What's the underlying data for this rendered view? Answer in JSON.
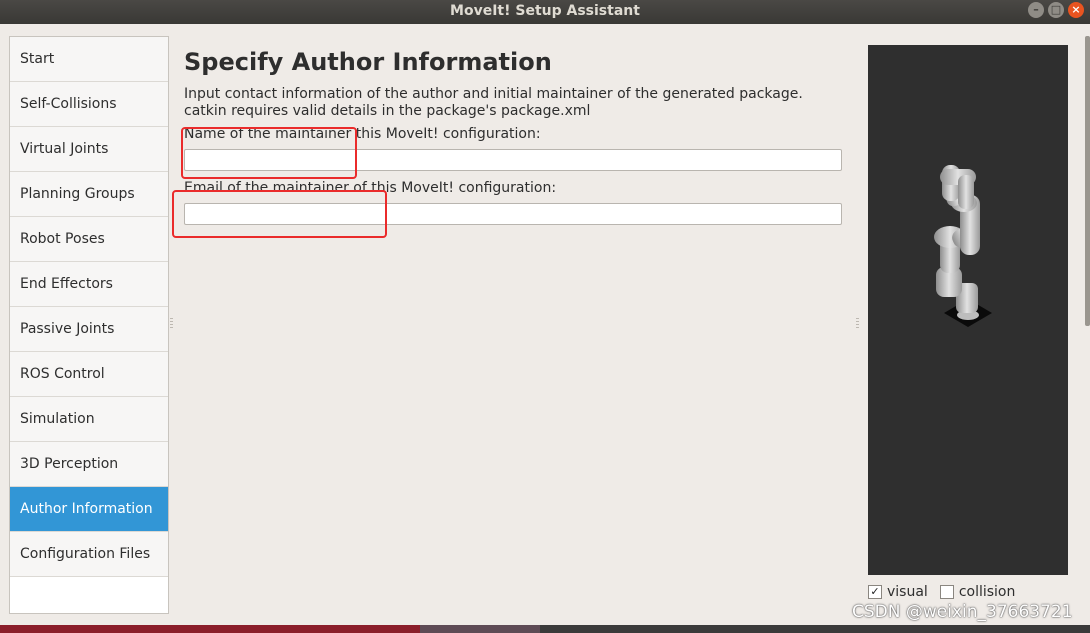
{
  "window": {
    "title": "MoveIt! Setup Assistant"
  },
  "window_buttons": [
    "–",
    "□",
    "×"
  ],
  "sidebar": {
    "items": [
      {
        "label": "Start"
      },
      {
        "label": "Self-Collisions"
      },
      {
        "label": "Virtual Joints"
      },
      {
        "label": "Planning Groups"
      },
      {
        "label": "Robot Poses"
      },
      {
        "label": "End Effectors"
      },
      {
        "label": "Passive Joints"
      },
      {
        "label": "ROS Control"
      },
      {
        "label": "Simulation"
      },
      {
        "label": "3D Perception"
      },
      {
        "label": "Author Information"
      },
      {
        "label": "Configuration Files"
      }
    ],
    "active": "Author Information",
    "active_color": "#3296d6"
  },
  "main": {
    "title": "Specify Author Information",
    "description": "Input contact information of the author and initial maintainer of the generated package. catkin requires valid details in the package's package.xml",
    "name_label": "Name of the maintainer this MoveIt! configuration:",
    "name_value": "",
    "email_label": "Email of the maintainer of this MoveIt! configuration:",
    "email_value": ""
  },
  "viewer": {
    "visual_label": "visual",
    "visual_checked": true,
    "collision_label": "collision",
    "collision_checked": false,
    "check_mark": "✓"
  },
  "annotation_color": "#ea2b2b",
  "watermark": "CSDN @weixin_37663721"
}
